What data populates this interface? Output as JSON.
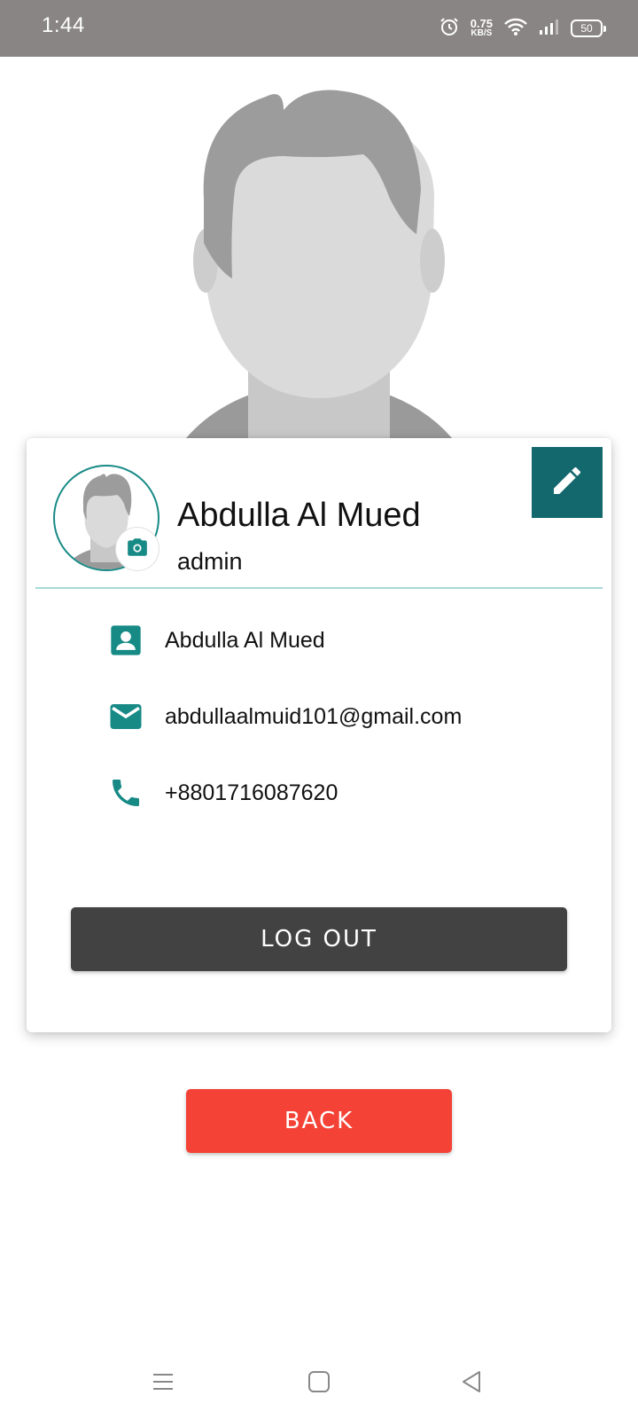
{
  "status_bar": {
    "time": "1:44",
    "net_speed_value": "0.75",
    "net_speed_unit": "KB/S",
    "battery_level": "50",
    "icons": [
      "alarm-icon",
      "wifi-icon",
      "signal-icon",
      "battery-icon"
    ]
  },
  "profile": {
    "name": "Abdulla Al Mued",
    "role": "admin"
  },
  "info": {
    "name": "Abdulla Al Mued",
    "email": "abdullaalmuid101@gmail.com",
    "phone": "+8801716087620"
  },
  "buttons": {
    "logout": "LOG OUT",
    "back": "BACK"
  },
  "colors": {
    "accent": "#13686e",
    "teal_icon": "#178a86",
    "logout_bg": "#424242",
    "back_bg": "#f44336",
    "status_bar": "#898585"
  },
  "nav": {
    "icons": [
      "menu-icon",
      "home-icon",
      "back-icon"
    ]
  }
}
